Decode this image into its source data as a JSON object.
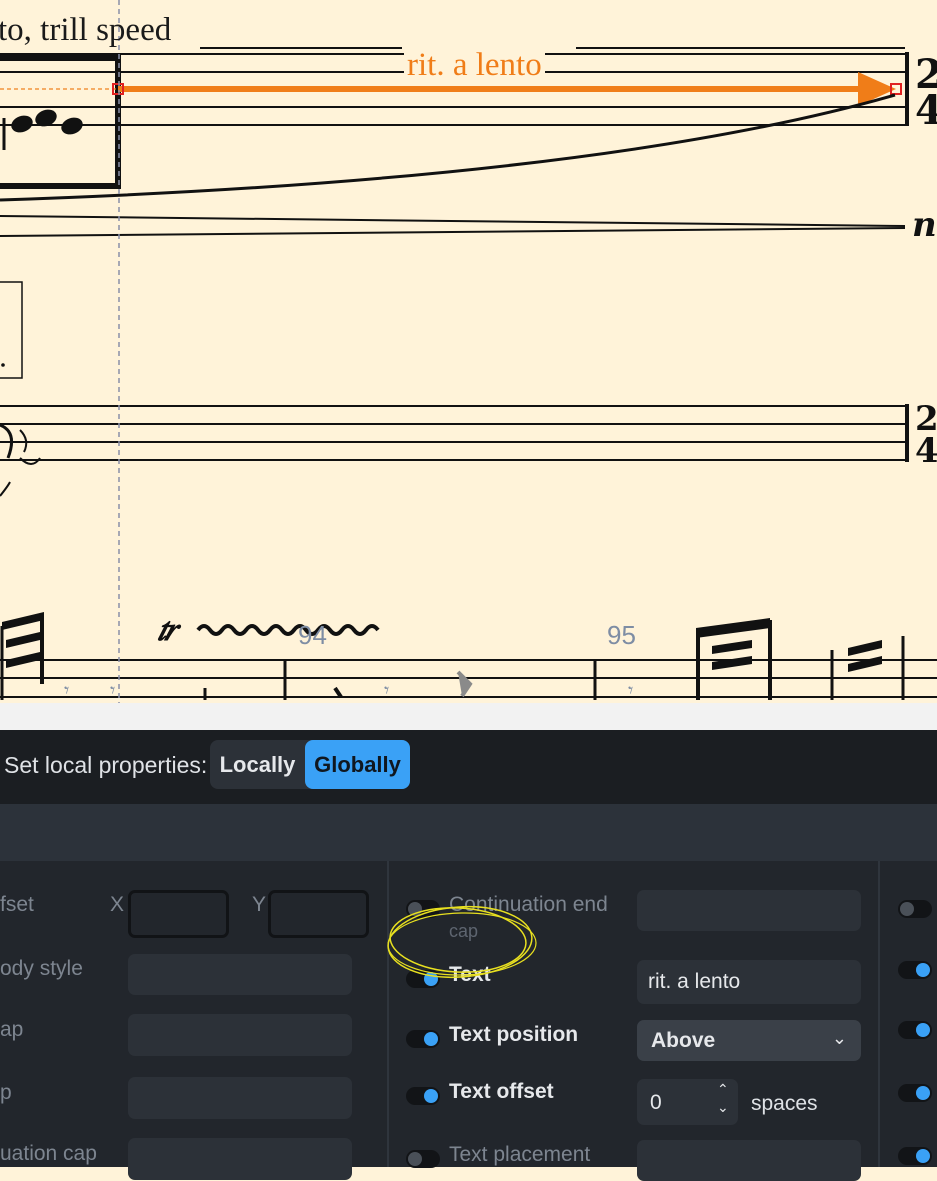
{
  "score": {
    "tempo_text": "to, trill speed",
    "line_text": "rit. a lento",
    "bar_numbers": [
      "94",
      "95"
    ],
    "line_color": "#f07d18",
    "trill_symbol": "tr"
  },
  "panel": {
    "toolbar": {
      "label": "Set local properties:",
      "locally": "Locally",
      "globally": "Globally",
      "selected": "Globally"
    },
    "left_column": {
      "offset_label": "fset",
      "x_label": "X",
      "y_label": "Y",
      "body_style_label": "ody style",
      "cap_label": "ap",
      "p_label": "p",
      "continuation_cap_label": "uation cap"
    },
    "middle_column": {
      "continuation_end_label": "Continuation end",
      "continuation_end_label_2": "cap",
      "text_label": "Text",
      "text_value": "rit. a lento",
      "text_position_label": "Text position",
      "text_position_value": "Above",
      "text_offset_label": "Text offset",
      "text_offset_value": "0",
      "text_offset_units": "spaces",
      "text_placement_label": "Text placement"
    },
    "toggles": {
      "continuation_end": false,
      "text": true,
      "text_position": true,
      "text_offset": true,
      "text_placement": false
    },
    "accent_color": "#3aa1f6"
  }
}
